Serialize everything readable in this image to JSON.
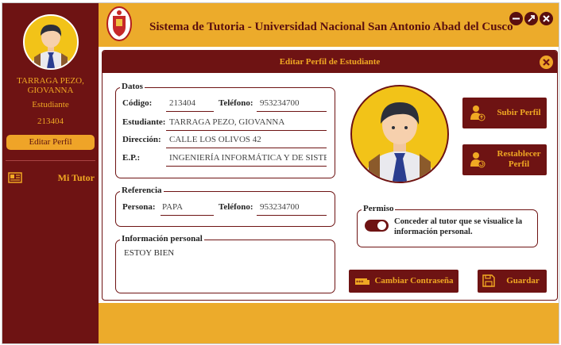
{
  "sidebar": {
    "name": "TARRAGA PEZO, GIOVANNA",
    "role": "Estudiante",
    "code": "213404",
    "edit_label": "Editar Perfil",
    "tutor_label": "Mi Tutor"
  },
  "header": {
    "title": "Sistema de Tutoria - Universidad Nacional San Antonio Abad del Cusco"
  },
  "panel": {
    "title": "Editar Perfil de Estudiante",
    "datos": {
      "legend": "Datos",
      "codigo_label": "Código:",
      "codigo_value": "213404",
      "telefono_label": "Teléfono:",
      "telefono_value": "953234700",
      "estudiante_label": "Estudiante:",
      "estudiante_value": "TARRAGA PEZO, GIOVANNA",
      "direccion_label": "Dirección:",
      "direccion_value": "CALLE LOS OLIVOS 42",
      "ep_label": "E.P.:",
      "ep_value": "INGENIERÍA INFORMÁTICA Y DE SISTE"
    },
    "referencia": {
      "legend": "Referencia",
      "persona_label": "Persona:",
      "persona_value": "PAPA",
      "telefono_label": "Teléfono:",
      "telefono_value": "953234700"
    },
    "info": {
      "legend": "Información personal",
      "value": "ESTOY BIEN"
    },
    "permiso": {
      "legend": "Permiso",
      "text": "Conceder al tutor que se visualice la información personal.",
      "enabled": true
    },
    "buttons": {
      "subir": "Subir Perfil",
      "restablecer": "Restablecer Perfil",
      "cambiar": "Cambiar Contraseña",
      "guardar": "Guardar"
    }
  },
  "colors": {
    "maroon": "#6e1313",
    "gold": "#ecab2b",
    "text_gold": "#f0a823"
  },
  "icons": [
    "user-avatar-icon",
    "id-card-icon",
    "minimize-icon",
    "maximize-icon",
    "close-icon",
    "user-upload-icon",
    "user-reset-icon",
    "password-icon",
    "save-icon"
  ]
}
